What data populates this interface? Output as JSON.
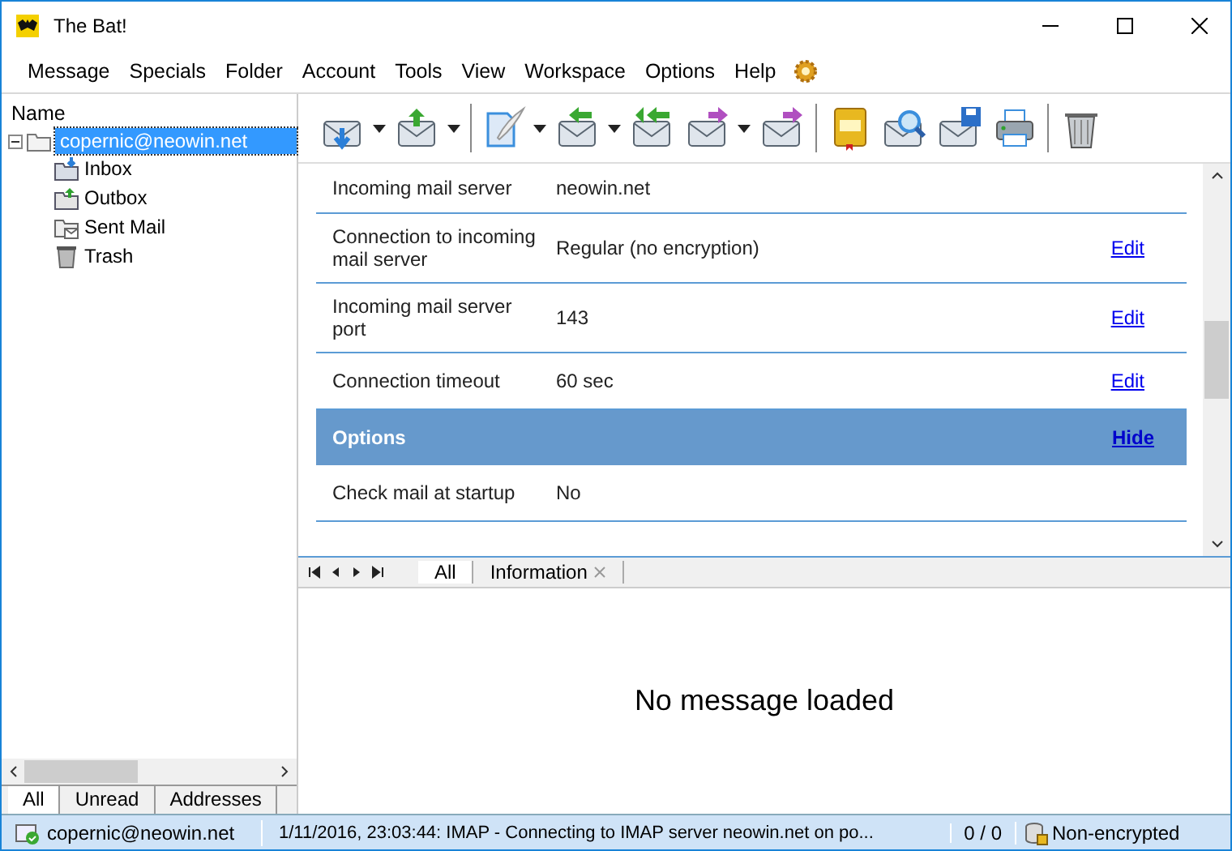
{
  "window": {
    "title": "The Bat!"
  },
  "menu": [
    "Message",
    "Specials",
    "Folder",
    "Account",
    "Tools",
    "View",
    "Workspace",
    "Options",
    "Help"
  ],
  "folder_tree": {
    "header": "Name",
    "account": {
      "label": "copernic@neowin.net",
      "selected": true,
      "expanded": true,
      "children": [
        {
          "label": "Inbox",
          "kind": "inbox"
        },
        {
          "label": "Outbox",
          "kind": "outbox"
        },
        {
          "label": "Sent Mail",
          "kind": "sent"
        },
        {
          "label": "Trash",
          "kind": "trash"
        }
      ]
    }
  },
  "folder_tabs": [
    {
      "label": "All",
      "selected": true
    },
    {
      "label": "Unread",
      "selected": false
    },
    {
      "label": "Addresses",
      "selected": false
    }
  ],
  "toolbar": [
    {
      "kind": "get",
      "dropdown": true
    },
    {
      "kind": "send",
      "dropdown": true
    },
    {
      "kind": "separator"
    },
    {
      "kind": "new",
      "dropdown": true
    },
    {
      "kind": "reply",
      "dropdown": true
    },
    {
      "kind": "replyall",
      "dropdown": false
    },
    {
      "kind": "forward",
      "dropdown": true
    },
    {
      "kind": "redirect",
      "dropdown": false
    },
    {
      "kind": "separator"
    },
    {
      "kind": "book",
      "dropdown": false
    },
    {
      "kind": "find",
      "dropdown": false
    },
    {
      "kind": "save",
      "dropdown": false
    },
    {
      "kind": "print",
      "dropdown": false
    },
    {
      "kind": "separator"
    },
    {
      "kind": "delete",
      "dropdown": false
    }
  ],
  "settings": [
    {
      "kind": "row",
      "label": "Incoming mail server",
      "value": "neowin.net"
    },
    {
      "kind": "row",
      "label": "Connection to incoming mail server",
      "value": "Regular (no encryption)",
      "action": "Edit"
    },
    {
      "kind": "row",
      "label": "Incoming mail server port",
      "value": "143",
      "action": "Edit"
    },
    {
      "kind": "row",
      "label": "Connection timeout",
      "value": "60 sec",
      "action": "Edit"
    },
    {
      "kind": "section",
      "label": "Options",
      "action": "Hide"
    },
    {
      "kind": "row",
      "label": "Check mail at startup",
      "value": "No"
    }
  ],
  "view_tabs": [
    {
      "label": "All",
      "selected": true,
      "closable": false
    },
    {
      "label": "Information",
      "selected": false,
      "closable": true
    }
  ],
  "preview": {
    "message": "No message loaded"
  },
  "status_bar": {
    "account": "copernic@neowin.net",
    "log": "1/11/2016, 23:03:44: IMAP  - Connecting to IMAP server neowin.net on po...",
    "count": "0 / 0",
    "security": "Non-encrypted"
  }
}
